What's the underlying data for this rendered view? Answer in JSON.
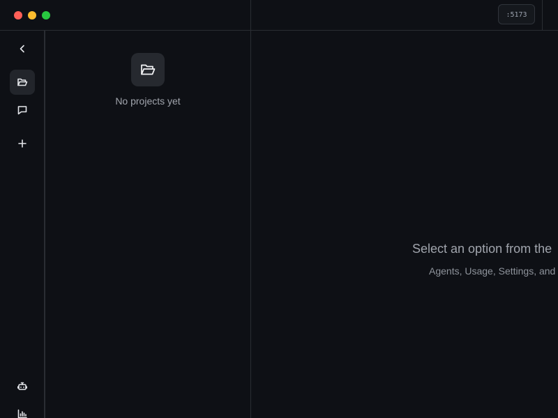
{
  "titlebar": {
    "port_label": ":5173"
  },
  "rail": {
    "items": [
      {
        "icon": "chevron-left-icon"
      },
      {
        "icon": "folder-open-icon",
        "active": true
      },
      {
        "icon": "message-square-icon"
      },
      {
        "icon": "plus-icon"
      },
      {
        "icon": "bot-icon"
      },
      {
        "icon": "bar-chart-icon"
      }
    ]
  },
  "projects": {
    "empty_text": "No projects yet"
  },
  "main": {
    "title": "Select an option from the",
    "subtitle": "Agents, Usage, Settings, and"
  },
  "colors": {
    "background": "#0e1015",
    "border": "#2a2d33",
    "active_item": "#22252b",
    "traffic_red": "#ff5f57",
    "traffic_yellow": "#febc2e",
    "traffic_green": "#28c840"
  }
}
